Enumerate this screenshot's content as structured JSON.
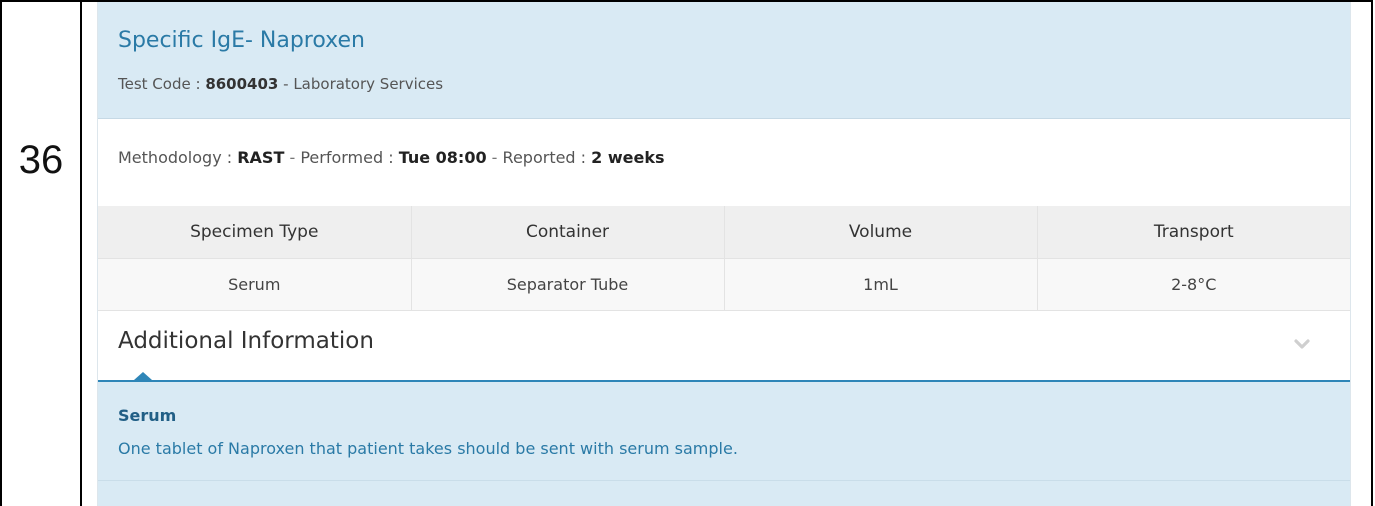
{
  "row_number": "36",
  "test": {
    "title": "Specific IgE- Naproxen",
    "code_label": "Test Code : ",
    "code": "8600403",
    "code_suffix": " - Laboratory Services"
  },
  "methodology": {
    "label": "Methodology : ",
    "value": "RAST",
    "performed_label": "Performed : ",
    "performed_value": "Tue 08:00",
    "reported_label": "Reported : ",
    "reported_value": "2 weeks",
    "separator": " - "
  },
  "specimen_table": {
    "headers": [
      "Specimen Type",
      "Container",
      "Volume",
      "Transport"
    ],
    "rows": [
      [
        "Serum",
        "Separator Tube",
        "1mL",
        "2-8°C"
      ]
    ]
  },
  "additional_info": {
    "title": "Additional Information",
    "chevron_icon": "chevron-down-icon",
    "heading": "Serum",
    "text": "One tablet of Naproxen that patient takes should be sent with serum sample."
  },
  "colors": {
    "header_bg": "#d9eaf4",
    "accent": "#2a7aa6",
    "rule": "#2f86b8"
  }
}
